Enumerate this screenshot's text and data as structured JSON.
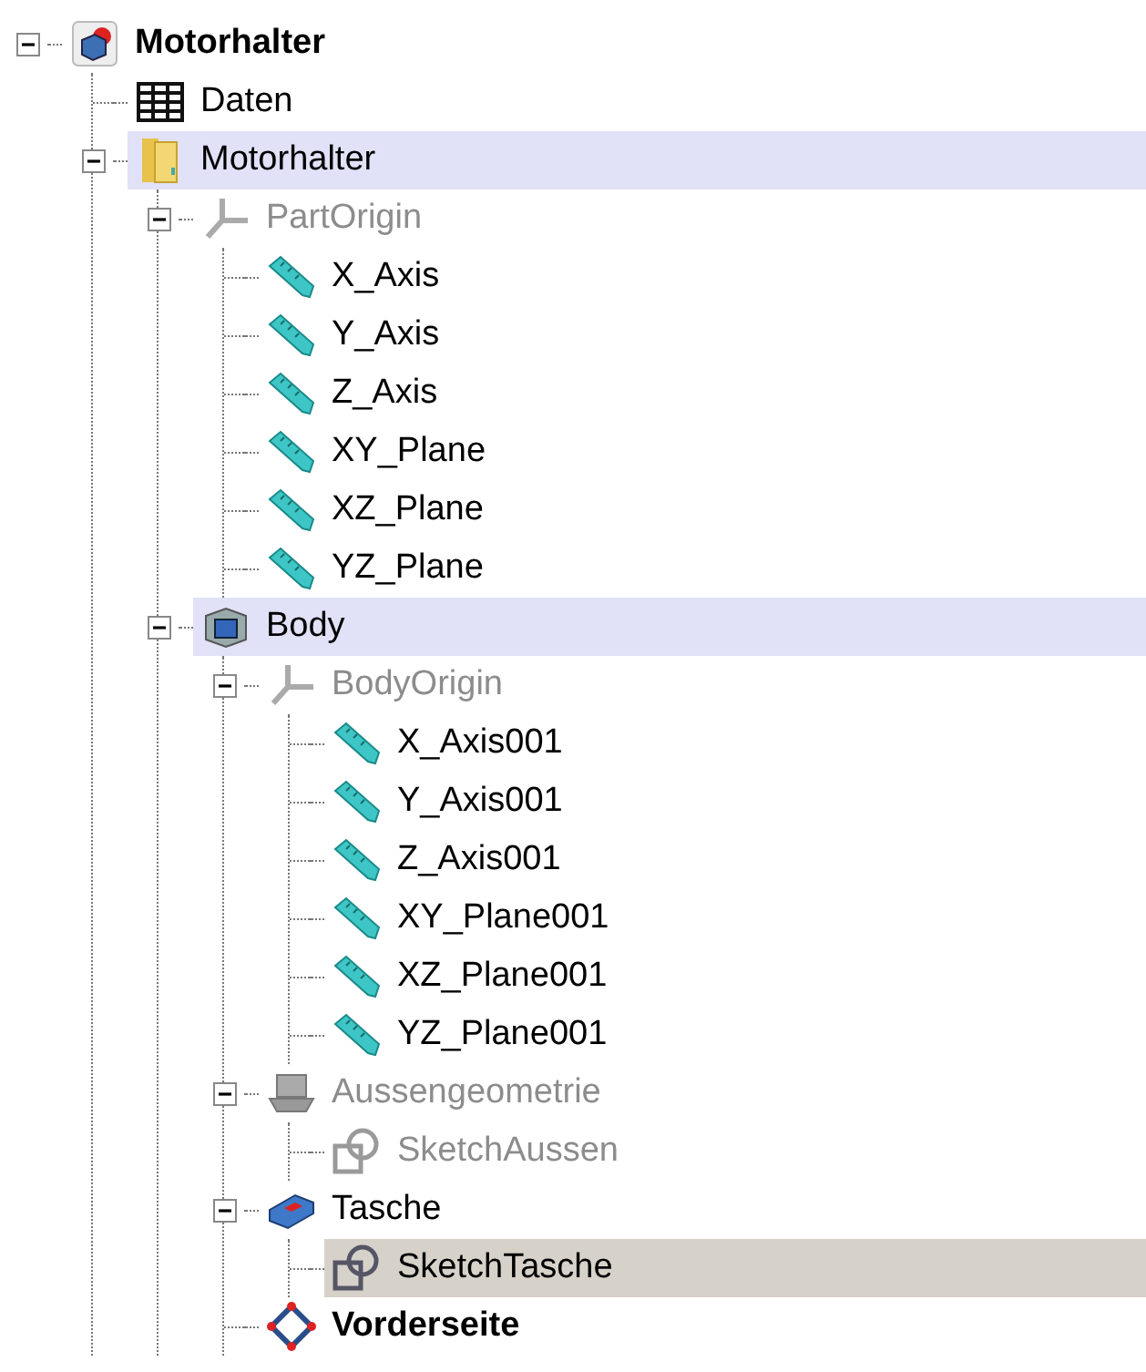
{
  "tree": [
    {
      "label": "Motorhalter",
      "kind": "part",
      "expanded": true,
      "bold": true,
      "dimmed": false,
      "active": false,
      "selected": false,
      "children": [
        {
          "label": "Daten",
          "kind": "spreadsheet",
          "bold": false,
          "dimmed": false,
          "active": false,
          "selected": false
        },
        {
          "label": "Motorhalter",
          "kind": "folder",
          "expanded": true,
          "bold": false,
          "dimmed": false,
          "active": true,
          "selected": false,
          "children": [
            {
              "label": "PartOrigin",
              "kind": "origin",
              "expanded": true,
              "bold": false,
              "dimmed": true,
              "active": false,
              "selected": false,
              "children": [
                {
                  "label": "X_Axis",
                  "kind": "axis",
                  "bold": false,
                  "dimmed": false,
                  "active": false,
                  "selected": false
                },
                {
                  "label": "Y_Axis",
                  "kind": "axis",
                  "bold": false,
                  "dimmed": false,
                  "active": false,
                  "selected": false
                },
                {
                  "label": "Z_Axis",
                  "kind": "axis",
                  "bold": false,
                  "dimmed": false,
                  "active": false,
                  "selected": false
                },
                {
                  "label": "XY_Plane",
                  "kind": "axis",
                  "bold": false,
                  "dimmed": false,
                  "active": false,
                  "selected": false
                },
                {
                  "label": "XZ_Plane",
                  "kind": "axis",
                  "bold": false,
                  "dimmed": false,
                  "active": false,
                  "selected": false
                },
                {
                  "label": "YZ_Plane",
                  "kind": "axis",
                  "bold": false,
                  "dimmed": false,
                  "active": false,
                  "selected": false
                }
              ]
            },
            {
              "label": "Body",
              "kind": "body",
              "expanded": true,
              "bold": false,
              "dimmed": false,
              "active": true,
              "selected": false,
              "children": [
                {
                  "label": "BodyOrigin",
                  "kind": "origin",
                  "expanded": true,
                  "bold": false,
                  "dimmed": true,
                  "active": false,
                  "selected": false,
                  "children": [
                    {
                      "label": "X_Axis001",
                      "kind": "axis",
                      "bold": false,
                      "dimmed": false,
                      "active": false,
                      "selected": false
                    },
                    {
                      "label": "Y_Axis001",
                      "kind": "axis",
                      "bold": false,
                      "dimmed": false,
                      "active": false,
                      "selected": false
                    },
                    {
                      "label": "Z_Axis001",
                      "kind": "axis",
                      "bold": false,
                      "dimmed": false,
                      "active": false,
                      "selected": false
                    },
                    {
                      "label": "XY_Plane001",
                      "kind": "axis",
                      "bold": false,
                      "dimmed": false,
                      "active": false,
                      "selected": false
                    },
                    {
                      "label": "XZ_Plane001",
                      "kind": "axis",
                      "bold": false,
                      "dimmed": false,
                      "active": false,
                      "selected": false
                    },
                    {
                      "label": "YZ_Plane001",
                      "kind": "axis",
                      "bold": false,
                      "dimmed": false,
                      "active": false,
                      "selected": false
                    }
                  ]
                },
                {
                  "label": "Aussengeometrie",
                  "kind": "pad",
                  "expanded": true,
                  "bold": false,
                  "dimmed": true,
                  "active": false,
                  "selected": false,
                  "children": [
                    {
                      "label": "SketchAussen",
                      "kind": "sketch",
                      "bold": false,
                      "dimmed": true,
                      "active": false,
                      "selected": false
                    }
                  ]
                },
                {
                  "label": "Tasche",
                  "kind": "pocket",
                  "expanded": true,
                  "bold": false,
                  "dimmed": false,
                  "active": false,
                  "selected": false,
                  "children": [
                    {
                      "label": "SketchTasche",
                      "kind": "sketch",
                      "bold": false,
                      "dimmed": false,
                      "active": false,
                      "selected": true
                    }
                  ]
                },
                {
                  "label": "Vorderseite",
                  "kind": "plane",
                  "bold": true,
                  "dimmed": false,
                  "active": false,
                  "selected": false
                }
              ]
            }
          ]
        }
      ]
    }
  ]
}
